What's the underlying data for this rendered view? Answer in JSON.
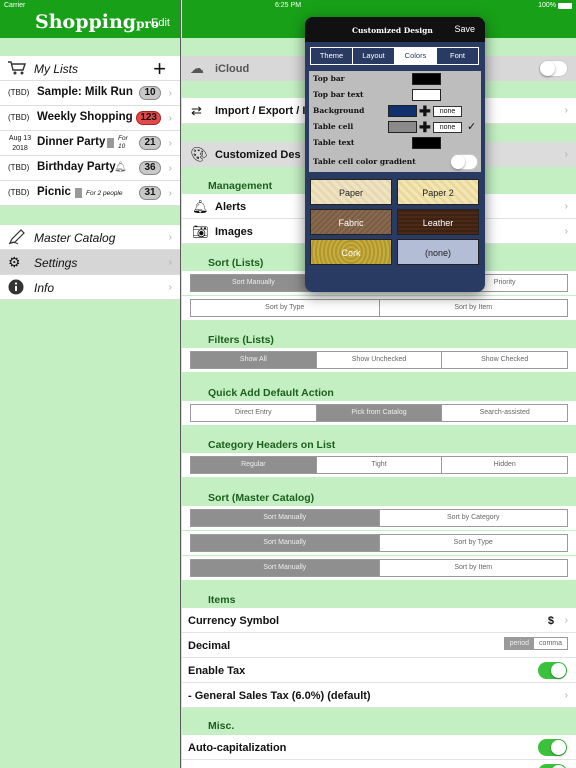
{
  "status": {
    "carrier": "Carrier",
    "time": "6:25 PM",
    "battery": "100%"
  },
  "left": {
    "brand": "Shopping",
    "brand_suffix": "pro",
    "edit": "Edit",
    "my_lists": "My Lists",
    "lists": [
      {
        "date": "(TBD)",
        "name": "Sample: Milk Run",
        "count": "10",
        "count_color": "#c8c8c8"
      },
      {
        "date": "(TBD)",
        "name": "Weekly Shopping",
        "count": "123",
        "count_color": "#e24a4a"
      },
      {
        "date_line1": "Aug 13",
        "date_line2": "2018",
        "name": "Dinner Party",
        "note_line1": "For",
        "note_line2": "10",
        "count": "21"
      },
      {
        "date": "(TBD)",
        "name": "Birthday Party",
        "count": "36"
      },
      {
        "date": "(TBD)",
        "name": "Picnic",
        "note": "For 2 people",
        "count": "31"
      }
    ],
    "nav": [
      {
        "label": "Master Catalog",
        "icon": "pencil-icon"
      },
      {
        "label": "Settings",
        "icon": "gear-icon"
      },
      {
        "label": "Info",
        "icon": "info-icon"
      }
    ]
  },
  "settings": {
    "icloud": "iCloud",
    "import_export": "Import / Export / I",
    "customized_design": "Customized Des",
    "management_header": "Management",
    "alerts": "Alerts",
    "images": "Images",
    "sort_lists_header": "Sort (Lists)",
    "sort_lists_row1": [
      "Sort Manually",
      "",
      "Priority"
    ],
    "sort_lists_row2": [
      "Sort by Type",
      "Sort by Item"
    ],
    "filters_header": "Filters (Lists)",
    "filters": [
      "Show All",
      "Show Unchecked",
      "Show Checked"
    ],
    "quick_add_header": "Quick Add Default Action",
    "quick_add": [
      "Direct Entry",
      "Pick from Catalog",
      "Search-assisted"
    ],
    "category_header": "Category Headers on List",
    "category": [
      "Regular",
      "Tight",
      "Hidden"
    ],
    "sort_master_header": "Sort (Master Catalog)",
    "sort_master_row1": [
      "Sort Manually",
      "Sort by Category"
    ],
    "sort_master_row2": [
      "Sort Manually",
      "Sort by Type"
    ],
    "sort_master_row3": [
      "Sort Manually",
      "Sort by Item"
    ],
    "items_header": "Items",
    "currency_symbol": "Currency Symbol",
    "currency_value": "$",
    "decimal": "Decimal",
    "decimal_options": [
      "period",
      "comma"
    ],
    "enable_tax": "Enable Tax",
    "general_sales_tax": "- General Sales Tax (6.0%) (default)",
    "misc_header": "Misc.",
    "auto_cap": "Auto-capitalization"
  },
  "popover": {
    "title": "Customized Design",
    "save": "Save",
    "tabs": [
      "Theme",
      "Layout",
      "Colors",
      "Font"
    ],
    "selected_tab": "Colors",
    "top_bar": "Top bar",
    "top_bar_text": "Top bar text",
    "background": "Background",
    "table_cell": "Table cell",
    "table_text": "Table text",
    "gradient": "Table cell color gradient",
    "none_label": "none",
    "colors": {
      "top_bar": "#000000",
      "top_bar_text": "#ffffff",
      "background": "#10306e",
      "table_cell": "#8a8a8a",
      "table_text": "#000000"
    },
    "textures": [
      "Paper",
      "Paper 2",
      "Fabric",
      "Leather",
      "Cork",
      "(none)"
    ]
  }
}
